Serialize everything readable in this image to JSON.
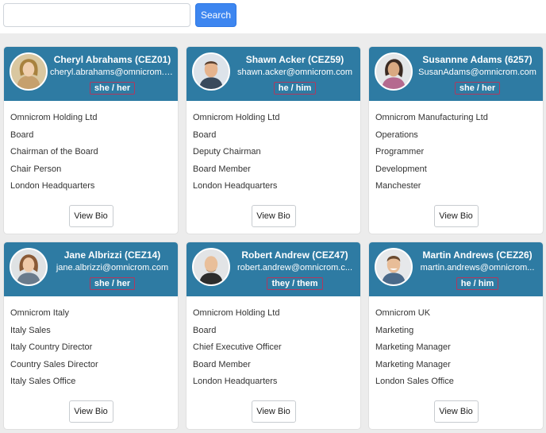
{
  "search": {
    "value": "",
    "placeholder": "",
    "button_label": "Search"
  },
  "cards": [
    {
      "name": "Cheryl Abrahams (CEZ01)",
      "email": "cheryl.abrahams@omnicrom.com",
      "pronouns": "she / her",
      "details": [
        "Omnicrom Holding Ltd",
        "Board",
        "Chairman of the Board",
        "Chair Person",
        "London Headquarters"
      ],
      "bio_label": "View Bio"
    },
    {
      "name": "Shawn Acker (CEZ59)",
      "email": "shawn.acker@omnicrom.com",
      "pronouns": "he / him",
      "details": [
        "Omnicrom Holding Ltd",
        "Board",
        "Deputy Chairman",
        "Board Member",
        "London Headquarters"
      ],
      "bio_label": "View Bio"
    },
    {
      "name": "Susannne Adams (6257)",
      "email": "SusanAdams@omnicrom.com",
      "pronouns": "she / her",
      "details": [
        "Omnicrom Manufacturing Ltd",
        "Operations",
        "Programmer",
        "Development",
        "Manchester"
      ],
      "bio_label": "View Bio"
    },
    {
      "name": "Jane Albrizzi (CEZ14)",
      "email": "jane.albrizzi@omnicrom.com",
      "pronouns": "she / her",
      "details": [
        "Omnicrom Italy",
        "Italy Sales",
        "Italy Country Director",
        "Country Sales Director",
        "Italy Sales Office"
      ],
      "bio_label": "View Bio"
    },
    {
      "name": "Robert Andrew (CEZ47)",
      "email": "robert.andrew@omnicrom.c...",
      "pronouns": "they / them",
      "details": [
        "Omnicrom Holding Ltd",
        "Board",
        "Chief Executive Officer",
        "Board Member",
        "London Headquarters"
      ],
      "bio_label": "View Bio"
    },
    {
      "name": "Martin Andrews (CEZ26)",
      "email": "martin.andrews@omnicrom...",
      "pronouns": "he / him",
      "details": [
        "Omnicrom UK",
        "Marketing",
        "Marketing Manager",
        "Marketing Manager",
        "London Sales Office"
      ],
      "bio_label": "View Bio"
    }
  ],
  "colors": {
    "header": "#2e7ba3",
    "search_button": "#3d86f0",
    "badge_border": "#b0385e",
    "page_background": "#ececec"
  }
}
